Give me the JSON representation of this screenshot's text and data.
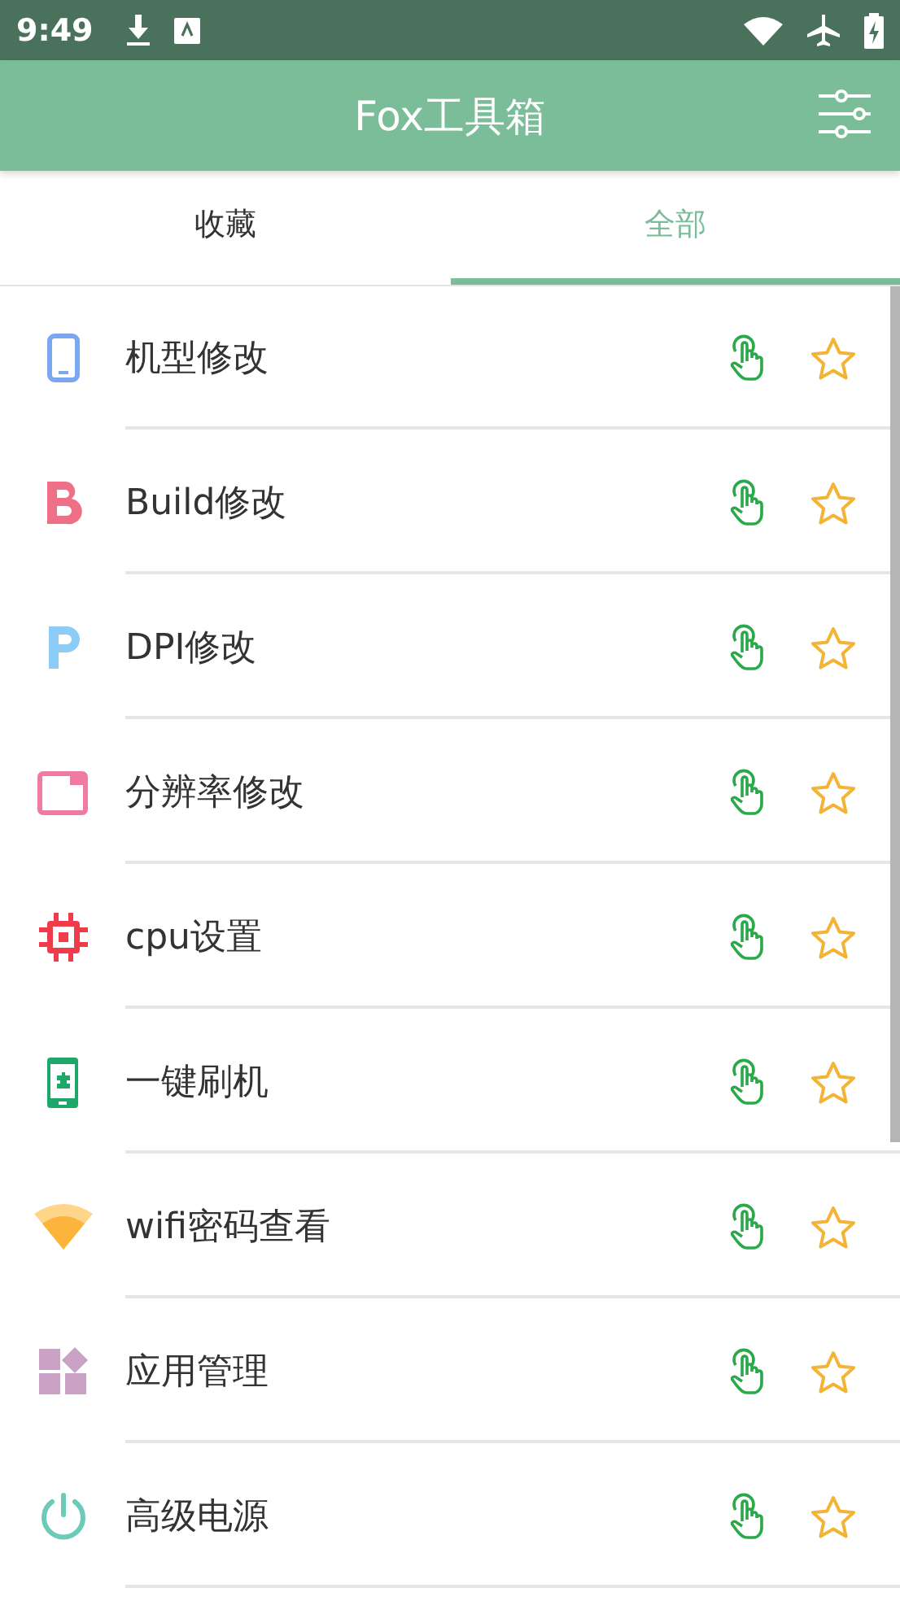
{
  "status_bar": {
    "time": "9:49"
  },
  "app_bar": {
    "title": "Fox工具箱"
  },
  "tabs": [
    {
      "label": "收藏",
      "selected": false
    },
    {
      "label": "全部",
      "selected": true
    }
  ],
  "tools": [
    {
      "kind": "phone",
      "label": "机型修改",
      "favorite": false
    },
    {
      "kind": "letter-b",
      "label": "Build修改",
      "favorite": false
    },
    {
      "kind": "letter-p",
      "label": "DPI修改",
      "favorite": false
    },
    {
      "kind": "window",
      "label": "分辨率修改",
      "favorite": false
    },
    {
      "kind": "chip",
      "label": "cpu设置",
      "favorite": false
    },
    {
      "kind": "flash",
      "label": "一键刷机",
      "favorite": false
    },
    {
      "kind": "wifi",
      "label": "wifi密码查看",
      "favorite": false
    },
    {
      "kind": "apps",
      "label": "应用管理",
      "favorite": false
    },
    {
      "kind": "power",
      "label": "高级电源",
      "favorite": false
    }
  ]
}
